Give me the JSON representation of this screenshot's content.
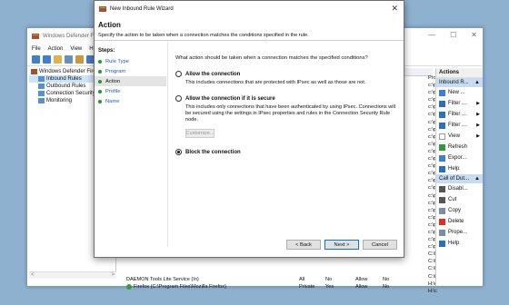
{
  "mmc": {
    "title": "Windows Defender Fire",
    "menu": [
      "File",
      "Action",
      "View",
      "He"
    ],
    "tree": [
      {
        "label": "Windows Defender Fire",
        "selected": false,
        "indent": 0
      },
      {
        "label": "Inbound Rules",
        "selected": true,
        "indent": 1
      },
      {
        "label": "Outbound Rules",
        "selected": false,
        "indent": 1
      },
      {
        "label": "Connection Security",
        "selected": false,
        "indent": 1
      },
      {
        "label": "Monitoring",
        "selected": false,
        "indent": 1
      }
    ],
    "rows": [
      {
        "name": "DAEMON Tools Lite Service (In)",
        "group": "",
        "profile": "All",
        "enabled": "No",
        "action": "Allow",
        "override": "No",
        "program": "C:\\P",
        "checked": false
      },
      {
        "name": "Firefox (C:\\Program Files\\Mozilla Firefox)",
        "group": "",
        "profile": "Private",
        "enabled": "Yes",
        "action": "Allow",
        "override": "No",
        "program": "C:\\P",
        "checked": true
      }
    ],
    "program_column": [
      "Prog",
      "c:\\p",
      "c:\\p",
      "c:\\p",
      "c:\\p",
      "c:\\p",
      "c:\\p",
      "c:\\p",
      "c:\\p",
      "c:\\p",
      "c:\\p",
      "c:\\p",
      "c:\\p",
      "c:\\p",
      "c:\\p",
      "c:\\p",
      "c:\\p",
      "c:\\p",
      "c:\\p",
      "c:\\p",
      "c:\\p",
      "c:\\p",
      "c:\\p",
      "c:\\p",
      "C:\\P",
      "C:\\P",
      "C:\\P",
      "C:\\P",
      "H:\\c",
      "H:\\c"
    ],
    "actions": {
      "header": "Actions",
      "group1": "Inbound R...",
      "items1": [
        {
          "label": "New ...",
          "icon": "new-rule-icon",
          "color": "#3c7fd8"
        },
        {
          "label": "Filter ...",
          "icon": "filter-icon",
          "color": "#2a6fc0",
          "sub": true
        },
        {
          "label": "Filter ...",
          "icon": "filter-icon",
          "color": "#2a6fc0",
          "sub": true
        },
        {
          "label": "Filter ...",
          "icon": "filter-icon",
          "color": "#2a6fc0",
          "sub": true
        },
        {
          "label": "View",
          "icon": "view-icon",
          "color": "#ffffff",
          "sub": true
        },
        {
          "label": "Refresh",
          "icon": "refresh-icon",
          "color": "#2f9a3c"
        },
        {
          "label": "Expor...",
          "icon": "export-icon",
          "color": "#3c7fd8"
        },
        {
          "label": "Help",
          "icon": "help-icon",
          "color": "#2a6fc0"
        }
      ],
      "group2": "Call of Dut...",
      "items2": [
        {
          "label": "Disabl...",
          "icon": "disable-icon",
          "color": "#555555"
        },
        {
          "label": "Cut",
          "icon": "cut-icon",
          "color": "#555555"
        },
        {
          "label": "Copy",
          "icon": "copy-icon",
          "color": "#7a8da6"
        },
        {
          "label": "Delete",
          "icon": "delete-icon",
          "color": "#d93025"
        },
        {
          "label": "Prope...",
          "icon": "properties-icon",
          "color": "#7a8da6"
        },
        {
          "label": "Help",
          "icon": "help-icon",
          "color": "#2a6fc0"
        }
      ]
    }
  },
  "wizard": {
    "title": "New Inbound Rule Wizard",
    "heading": "Action",
    "subheading": "Specify the action to be taken when a connection matches the conditions specified in the rule.",
    "steps_label": "Steps:",
    "steps": [
      {
        "label": "Rule Type",
        "current": false
      },
      {
        "label": "Program",
        "current": false
      },
      {
        "label": "Action",
        "current": true
      },
      {
        "label": "Profile",
        "current": false
      },
      {
        "label": "Name",
        "current": false
      }
    ],
    "prompt": "What action should be taken when a connection matches the specified conditions?",
    "options": [
      {
        "label": "Allow the connection",
        "desc": "This includes connections that are protected with IPsec as well as those are not.",
        "selected": false
      },
      {
        "label": "Allow the connection if it is secure",
        "desc": "This includes only connections that have been authenticated by using IPsec.  Connections will be secured using the settings in IPsec properties and rules in the Connection Security Rule node.",
        "selected": false
      },
      {
        "label": "Block the connection",
        "desc": "",
        "selected": true
      }
    ],
    "customize": "Customize...",
    "buttons": {
      "back": "< Back",
      "next": "Next >",
      "cancel": "Cancel"
    }
  }
}
